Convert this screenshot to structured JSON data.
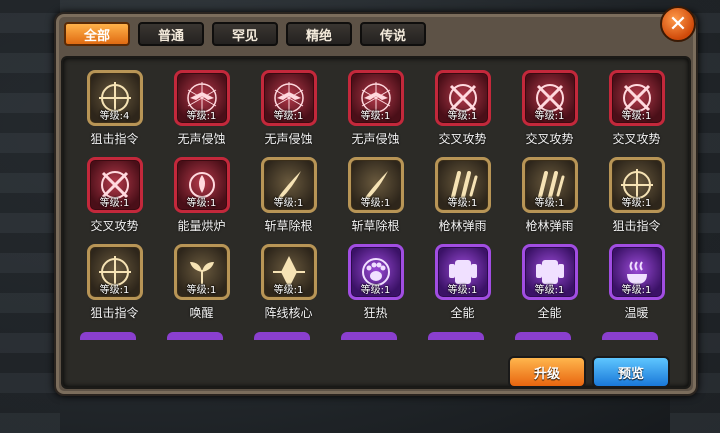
{
  "tabs": [
    {
      "label": "全部",
      "active": true
    },
    {
      "label": "普通",
      "active": false
    },
    {
      "label": "罕见",
      "active": false
    },
    {
      "label": "精绝",
      "active": false
    },
    {
      "label": "传说",
      "active": false
    }
  ],
  "close_icon": "close-icon",
  "skills": [
    {
      "name": "狙击指令",
      "level": "等级:4",
      "rarity": "gold",
      "icon": "crosshair-icon"
    },
    {
      "name": "无声侵蚀",
      "level": "等级:1",
      "rarity": "red",
      "icon": "bat-web-icon"
    },
    {
      "name": "无声侵蚀",
      "level": "等级:1",
      "rarity": "red",
      "icon": "bat-web-icon"
    },
    {
      "name": "无声侵蚀",
      "level": "等级:1",
      "rarity": "red",
      "icon": "bat-web-icon"
    },
    {
      "name": "交叉攻势",
      "level": "等级:1",
      "rarity": "red",
      "icon": "cross-swords-icon"
    },
    {
      "name": "交叉攻势",
      "level": "等级:1",
      "rarity": "red",
      "icon": "cross-swords-icon"
    },
    {
      "name": "交叉攻势",
      "level": "等级:1",
      "rarity": "red",
      "icon": "cross-swords-icon"
    },
    {
      "name": "交叉攻势",
      "level": "等级:1",
      "rarity": "red",
      "icon": "cross-swords-icon"
    },
    {
      "name": "能量烘炉",
      "level": "等级:1",
      "rarity": "red",
      "icon": "furnace-icon"
    },
    {
      "name": "斩草除根",
      "level": "等级:1",
      "rarity": "gold",
      "icon": "slash-icon"
    },
    {
      "name": "斩草除根",
      "level": "等级:1",
      "rarity": "gold",
      "icon": "slash-icon"
    },
    {
      "name": "枪林弹雨",
      "level": "等级:1",
      "rarity": "gold",
      "icon": "bullets-icon"
    },
    {
      "name": "枪林弹雨",
      "level": "等级:1",
      "rarity": "gold",
      "icon": "bullets-icon"
    },
    {
      "name": "狙击指令",
      "level": "等级:1",
      "rarity": "gold",
      "icon": "crosshair-icon"
    },
    {
      "name": "狙击指令",
      "level": "等级:1",
      "rarity": "gold",
      "icon": "crosshair-icon"
    },
    {
      "name": "唤醒",
      "level": "等级:1",
      "rarity": "gold",
      "icon": "sprout-icon"
    },
    {
      "name": "阵线核心",
      "level": "等级:1",
      "rarity": "gold",
      "icon": "core-crystal-icon"
    },
    {
      "name": "狂热",
      "level": "等级:1",
      "rarity": "purple",
      "icon": "paw-icon"
    },
    {
      "name": "全能",
      "level": "等级:1",
      "rarity": "purple",
      "icon": "armor-icon"
    },
    {
      "name": "全能",
      "level": "等级:1",
      "rarity": "purple",
      "icon": "armor-icon"
    },
    {
      "name": "温暖",
      "level": "等级:1",
      "rarity": "purple",
      "icon": "steam-cup-icon"
    }
  ],
  "buttons": {
    "upgrade": "升级",
    "preview": "预览"
  },
  "colors": {
    "accent_orange": "#e8650f",
    "accent_blue": "#1a78d8",
    "rarity_gold": "#b89556",
    "rarity_red": "#c3283b",
    "rarity_purple": "#a14de2"
  }
}
